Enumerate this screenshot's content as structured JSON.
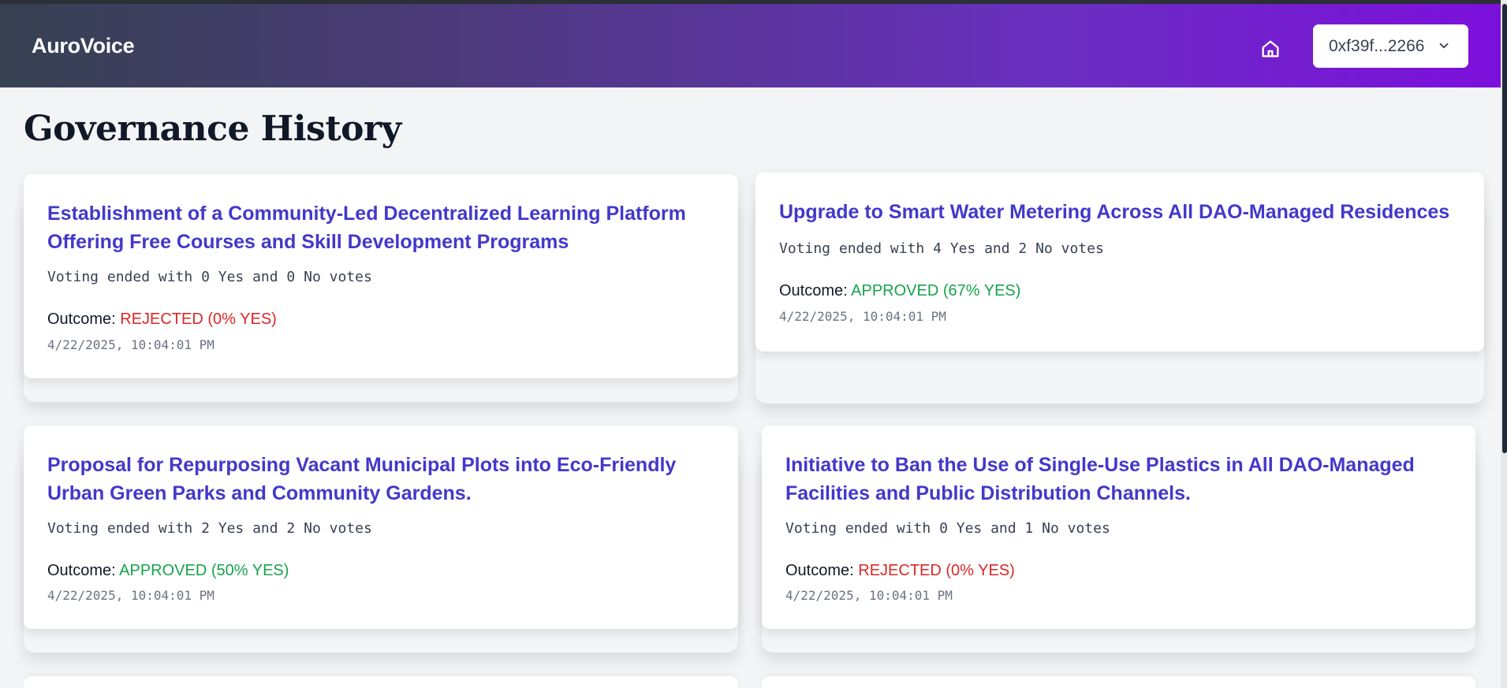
{
  "app": {
    "name": "AuroVoice"
  },
  "header": {
    "home_icon": "home-icon",
    "wallet": {
      "address": "0xf39f...2266",
      "chevron_icon": "chevron-down-icon"
    }
  },
  "page": {
    "title": "Governance History"
  },
  "colors": {
    "title": "#4338ca",
    "approved": "#16a34a",
    "rejected": "#dc2626"
  },
  "proposals": [
    {
      "title": "Establishment of a Community-Led Decentralized Learning Platform Offering Free Courses and Skill Development Programs",
      "votes_text": "Voting ended with 0 Yes and 0 No votes",
      "outcome_label": "Outcome:",
      "outcome_value": "REJECTED (0% YES)",
      "status": "rejected",
      "timestamp": "4/22/2025, 10:04:01 PM"
    },
    {
      "title": "Upgrade to Smart Water Metering Across All DAO-Managed Residences",
      "votes_text": "Voting ended with 4 Yes and 2 No votes",
      "outcome_label": "Outcome:",
      "outcome_value": "APPROVED (67% YES)",
      "status": "approved",
      "timestamp": "4/22/2025, 10:04:01 PM"
    },
    {
      "title": "Proposal for Repurposing Vacant Municipal Plots into Eco-Friendly Urban Green Parks and Community Gardens.",
      "votes_text": "Voting ended with 2 Yes and 2 No votes",
      "outcome_label": "Outcome:",
      "outcome_value": "APPROVED (50% YES)",
      "status": "approved",
      "timestamp": "4/22/2025, 10:04:01 PM"
    },
    {
      "title": "Initiative to Ban the Use of Single-Use Plastics in All DAO-Managed Facilities and Public Distribution Channels.",
      "votes_text": "Voting ended with 0 Yes and 1 No votes",
      "outcome_label": "Outcome:",
      "outcome_value": "REJECTED (0% YES)",
      "status": "rejected",
      "timestamp": "4/22/2025, 10:04:01 PM"
    }
  ]
}
